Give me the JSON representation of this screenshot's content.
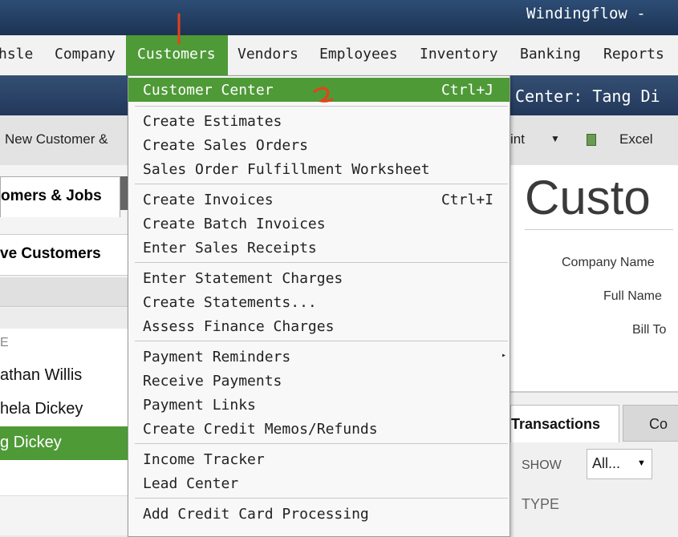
{
  "window": {
    "title": "Windingflow -"
  },
  "menubar": {
    "items": [
      {
        "label": "hsle",
        "name": "menu-vehicle"
      },
      {
        "label": "Company",
        "name": "menu-company"
      },
      {
        "label": "Customers",
        "name": "menu-customers"
      },
      {
        "label": "Vendors",
        "name": "menu-vendors"
      },
      {
        "label": "Employees",
        "name": "menu-employees"
      },
      {
        "label": "Inventory",
        "name": "menu-inventory"
      },
      {
        "label": "Banking",
        "name": "menu-banking"
      },
      {
        "label": "Reports",
        "name": "menu-reports"
      }
    ]
  },
  "subheader": {
    "title": "Center: Tang Di"
  },
  "toolbar": {
    "new_customer": "New Customer &",
    "print": "int",
    "excel": "Excel"
  },
  "left_panel": {
    "tab_label": "omers & Jobs",
    "filter_label": "ve Customers",
    "column_header": "E",
    "rows": [
      "athan Willis",
      "hela Dickey",
      "g Dickey"
    ]
  },
  "right_panel": {
    "big_title": "Custo",
    "labels": [
      "Company Name",
      "Full Name",
      "Bill To"
    ],
    "tab_transactions": "Transactions",
    "tab_contacts": "Co",
    "show_label": "SHOW",
    "show_value": "All...",
    "type_header": "TYPE"
  },
  "dropdown": {
    "items": [
      {
        "label": "Customer Center",
        "shortcut": "Ctrl+J",
        "highlight": true
      },
      {
        "label": "Create Estimates",
        "shortcut": ""
      },
      {
        "label": "Create Sales Orders",
        "shortcut": ""
      },
      {
        "label": "Sales Order Fulfillment Worksheet",
        "shortcut": ""
      },
      {
        "label": "Create Invoices",
        "shortcut": "Ctrl+I"
      },
      {
        "label": "Create Batch Invoices",
        "shortcut": ""
      },
      {
        "label": "Enter Sales Receipts",
        "shortcut": ""
      },
      {
        "label": "Enter Statement Charges",
        "shortcut": ""
      },
      {
        "label": "Create Statements...",
        "shortcut": ""
      },
      {
        "label": "Assess Finance Charges",
        "shortcut": ""
      },
      {
        "label": "Payment Reminders",
        "shortcut": "",
        "submenu": true
      },
      {
        "label": "Receive Payments",
        "shortcut": ""
      },
      {
        "label": "Payment Links",
        "shortcut": ""
      },
      {
        "label": "Create Credit Memos/Refunds",
        "shortcut": ""
      },
      {
        "label": "Income Tracker",
        "shortcut": ""
      },
      {
        "label": "Lead Center",
        "shortcut": ""
      },
      {
        "label": "Add Credit Card Processing",
        "shortcut": ""
      }
    ]
  },
  "colors": {
    "accent_green": "#4e9a37",
    "title_blue": "#1d3352",
    "annotation_red": "#e8401c"
  }
}
